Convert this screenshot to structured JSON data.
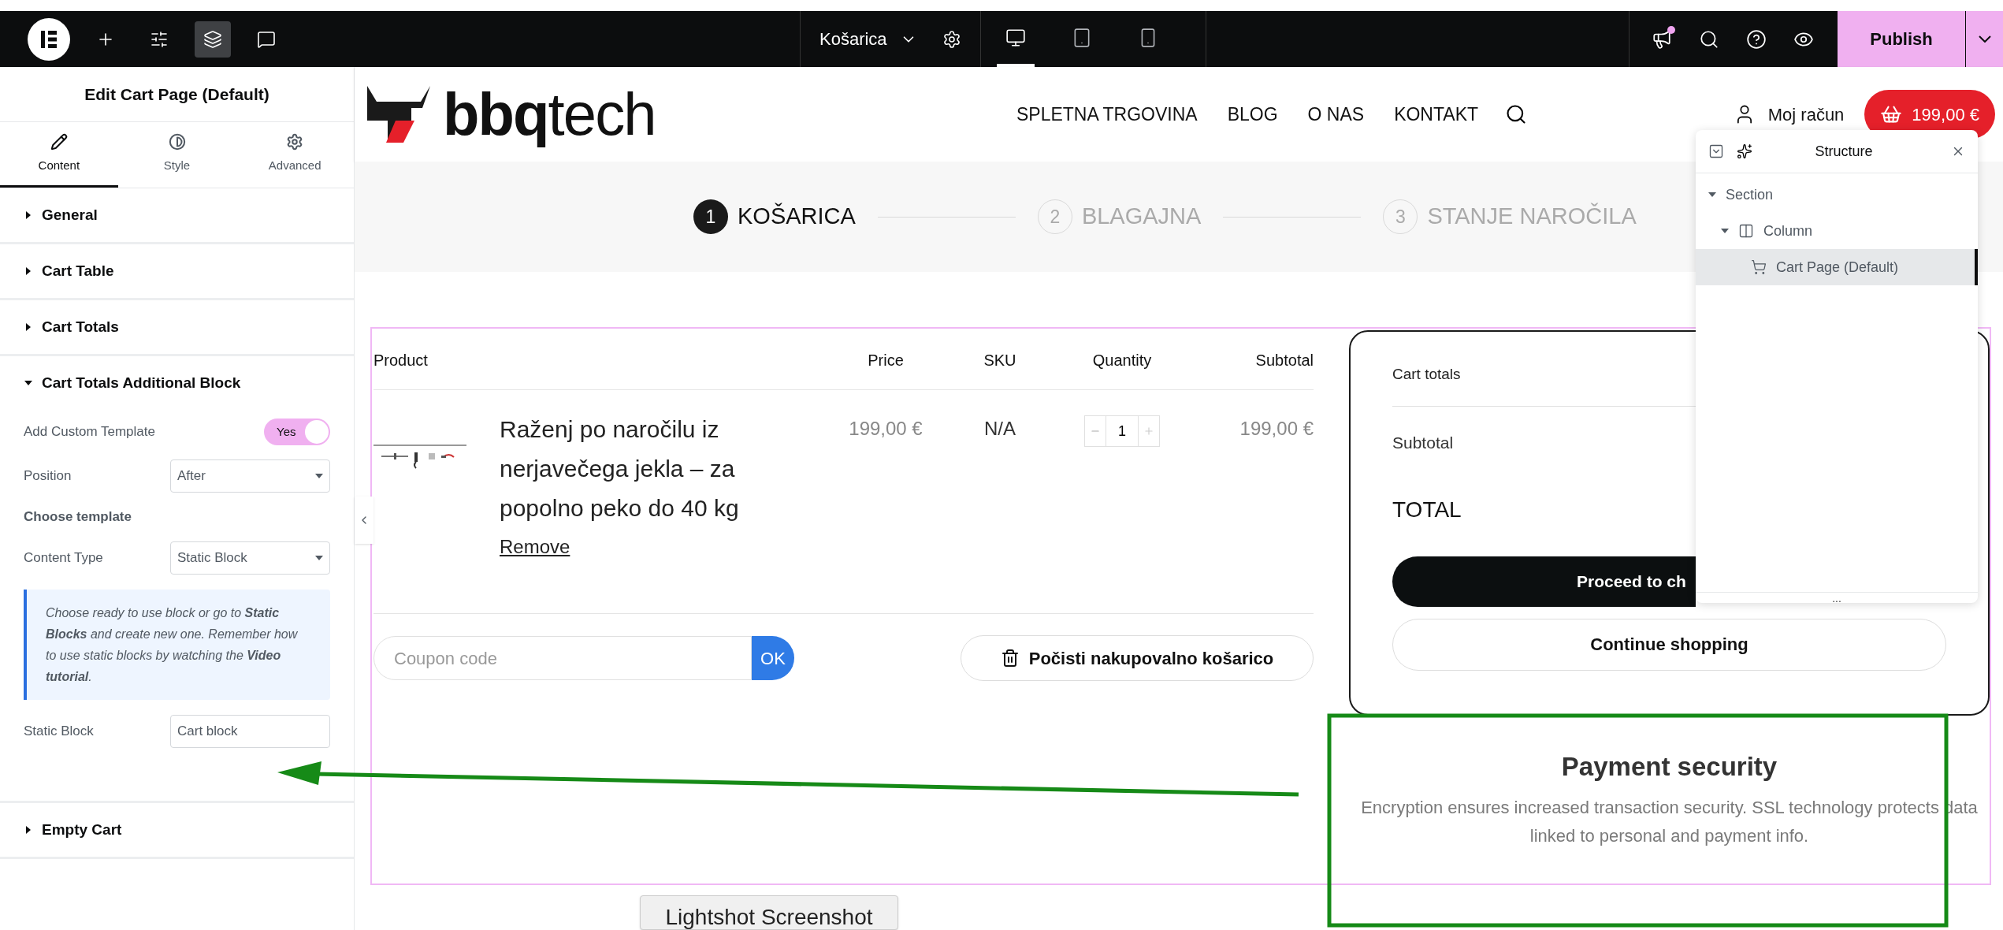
{
  "topbar": {
    "tools": [
      {
        "kind": "add",
        "selected": false
      },
      {
        "kind": "settings",
        "selected": false
      },
      {
        "kind": "layers",
        "selected": true
      },
      {
        "kind": "comments",
        "selected": false
      }
    ],
    "page_name": "Košarica",
    "devices": [
      {
        "kind": "desktop",
        "selected": true
      },
      {
        "kind": "tablet",
        "selected": false
      },
      {
        "kind": "mobile",
        "selected": false
      }
    ],
    "actions": [
      {
        "kind": "announcements",
        "unread": true
      },
      {
        "kind": "search",
        "unread": false
      },
      {
        "kind": "help",
        "unread": false
      },
      {
        "kind": "preview",
        "unread": false
      }
    ],
    "publish": "Publish"
  },
  "panel": {
    "title": "Edit Cart Page (Default)",
    "tabs": [
      {
        "kind": "content",
        "label": "Content",
        "selected": true
      },
      {
        "kind": "style",
        "label": "Style",
        "selected": false
      },
      {
        "kind": "advanced",
        "label": "Advanced",
        "selected": false
      }
    ],
    "sections": [
      {
        "title": "General",
        "expanded": false
      },
      {
        "title": "Cart Table",
        "expanded": false
      },
      {
        "title": "Cart Totals",
        "expanded": false
      },
      {
        "title": "Cart Totals Additional Block",
        "expanded": true,
        "controls": [
          {
            "kind": "toggle",
            "label": "Add Custom Template",
            "on": true,
            "value": "Yes"
          },
          {
            "kind": "select",
            "label": "Position",
            "value": "After"
          },
          {
            "kind": "heading",
            "label": "Choose template"
          },
          {
            "kind": "select",
            "label": "Content Type",
            "value": "Static Block"
          },
          {
            "kind": "note",
            "text": "Choose ready to use block or go to **Static Blocks** and create new one. Remember how to use static blocks by watching the **Video tutorial**."
          },
          {
            "kind": "text",
            "label": "Static Block",
            "value": "Cart block"
          }
        ]
      },
      {
        "title": "Empty Cart",
        "expanded": false
      }
    ]
  },
  "site": {
    "logo_bold": "bbq",
    "logo_light": "tech",
    "nav": [
      "SPLETNA TRGOVINA",
      "BLOG",
      "O NAS",
      "KONTAKT"
    ],
    "account": "Moj račun",
    "cart_total": "199,00 €"
  },
  "steps": [
    {
      "number": "1",
      "label": "KOŠARICA",
      "selected": true
    },
    {
      "number": "2",
      "label": "BLAGAJNA",
      "selected": false
    },
    {
      "number": "3",
      "label": "STANJE NAROČILA",
      "selected": false
    }
  ],
  "cart_table": {
    "columns": [
      "Product",
      "Price",
      "SKU",
      "Quantity",
      "Subtotal"
    ],
    "rows": [
      {
        "product": "Raženj po naročilu iz nerjavečega jekla – za popolno peko do 40 kg",
        "remove": "Remove",
        "price": "199,00 €",
        "sku": "N/A",
        "quantity": "1",
        "subtotal": "199,00 €"
      }
    ]
  },
  "coupon": {
    "placeholder": "Coupon code",
    "apply": "OK"
  },
  "clear_cart": "Počisti nakupovalno košarico",
  "totals": {
    "title": "Cart totals",
    "rows": [
      "Subtotal",
      "TOTAL"
    ],
    "checkout": "Proceed to ch",
    "continue": "Continue shopping"
  },
  "payment": {
    "title": "Payment security",
    "text": "Encryption ensures increased transaction security. SSL technology protects data linked to personal and payment info."
  },
  "structure": {
    "title": "Structure",
    "tree": [
      {
        "label": "Section",
        "expanded": true,
        "selected": false,
        "children": [
          {
            "label": "Column",
            "kind": "column",
            "expanded": true,
            "selected": false,
            "children": [
              {
                "label": "Cart Page (Default)",
                "kind": "widget",
                "selected": true
              }
            ]
          }
        ]
      }
    ],
    "footer": "..."
  },
  "tooltip": "Lightshot Screenshot"
}
